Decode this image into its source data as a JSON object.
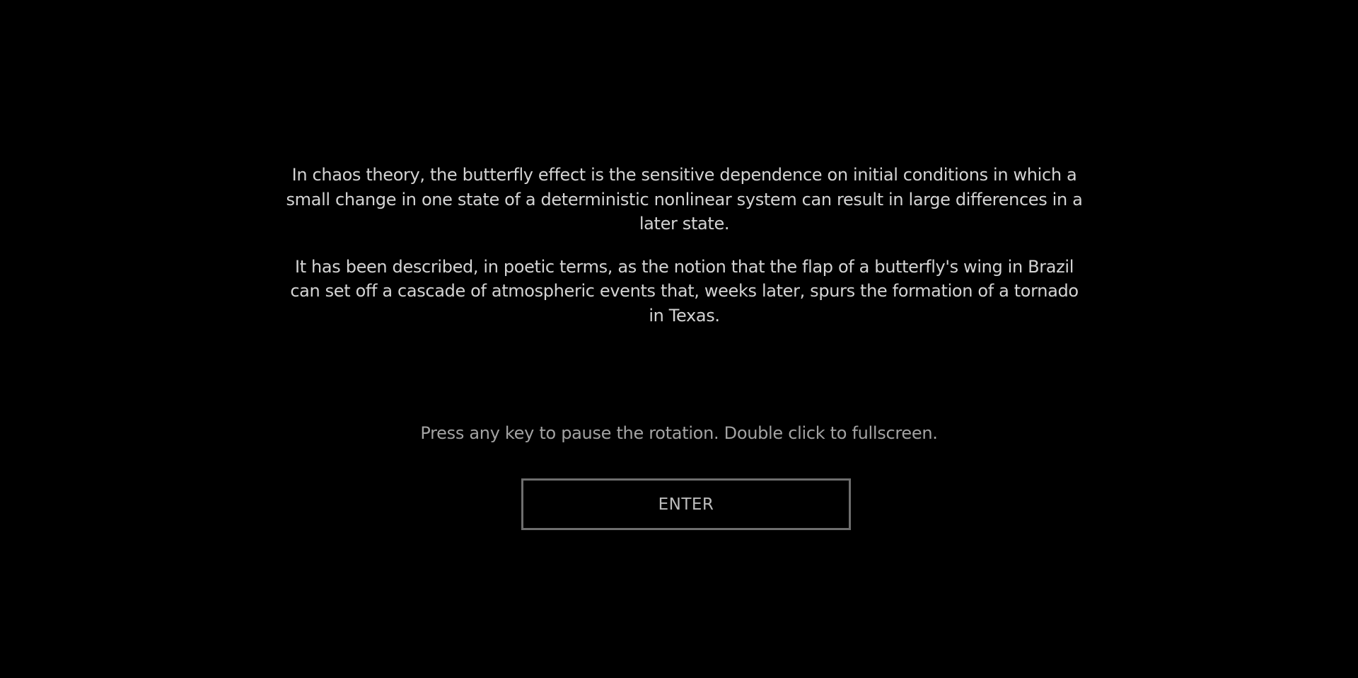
{
  "intro": {
    "paragraphs": [
      "In chaos theory, the butterfly effect is the sensitive dependence on initial conditions in which a small change in one state of a deterministic nonlinear system can result in large differences in a later state.",
      "It has been described, in poetic terms, as the notion that the flap of a butterfly's wing in Brazil can set off a cascade of atmospheric events that, weeks later, spurs the formation of a tornado in Texas."
    ]
  },
  "hint": "Press any key to pause the rotation. Double click to fullscreen.",
  "enter_button": {
    "label": "ENTER"
  },
  "colors": {
    "background": "#000000",
    "intro_text": "#d4d4d4",
    "hint_text": "#a3a3a3",
    "button_border": "#6e6e6e",
    "button_text": "#bdbdbd"
  }
}
